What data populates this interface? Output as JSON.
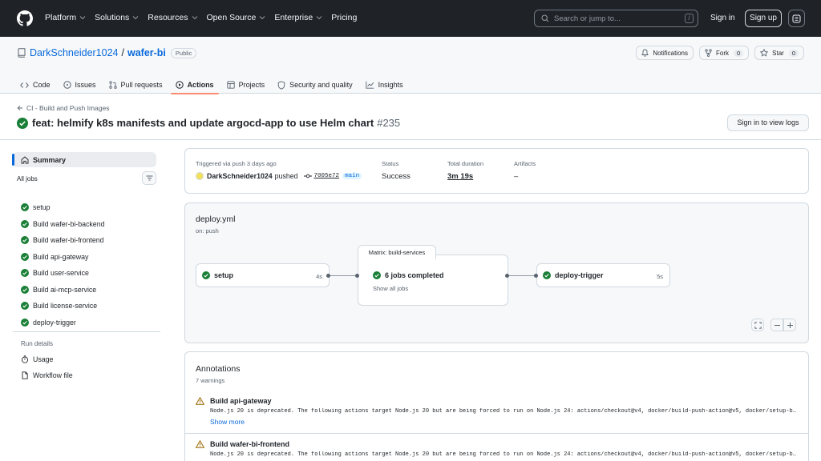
{
  "global_nav": {
    "items": [
      "Platform",
      "Solutions",
      "Resources",
      "Open Source",
      "Enterprise",
      "Pricing"
    ],
    "search_placeholder": "Search or jump to...",
    "search_shortcut": "/",
    "signin": "Sign in",
    "signup": "Sign up"
  },
  "repo": {
    "owner": "DarkSchneider1024",
    "separator": "/",
    "name": "wafer-bi",
    "visibility": "Public",
    "notifications": "Notifications",
    "fork_label": "Fork",
    "fork_count": "0",
    "star_label": "Star",
    "star_count": "0",
    "tabs": [
      "Code",
      "Issues",
      "Pull requests",
      "Actions",
      "Projects",
      "Security and quality",
      "Insights"
    ],
    "active_tab": "Actions"
  },
  "run": {
    "breadcrumb": "CI - Build and Push Images",
    "title": "feat: helmify k8s manifests and update argocd-app to use Helm chart",
    "number": "#235",
    "view_logs": "Sign in to view logs"
  },
  "sidebar": {
    "summary": "Summary",
    "all_jobs": "All jobs",
    "jobs": [
      "setup",
      "Build wafer-bi-backend",
      "Build wafer-bi-frontend",
      "Build api-gateway",
      "Build user-service",
      "Build ai-mcp-service",
      "Build license-service",
      "deploy-trigger"
    ],
    "run_details": "Run details",
    "usage": "Usage",
    "workflow_file": "Workflow file"
  },
  "summary": {
    "trigger_label": "Triggered via push 3 days ago",
    "user": "DarkSchneider1024",
    "action": "pushed",
    "commit": "7005e72",
    "branch": "main",
    "status_label": "Status",
    "status_value": "Success",
    "duration_label": "Total duration",
    "duration_value": "3m 19s",
    "artifacts_label": "Artifacts",
    "artifacts_value": "–"
  },
  "workflow": {
    "file": "deploy.yml",
    "on": "on: push",
    "setup_name": "setup",
    "setup_duration": "4s",
    "matrix_label": "Matrix: build-services",
    "matrix_status": "6 jobs completed",
    "matrix_link": "Show all jobs",
    "deploy_name": "deploy-trigger",
    "deploy_duration": "5s"
  },
  "annotations": {
    "title": "Annotations",
    "count": "7 warnings",
    "items": [
      {
        "job": "Build api-gateway",
        "message": "Node.js 20 is deprecated. The following actions target Node.js 20 but are being forced to run on Node.js 24: actions/checkout@v4, docker/build-push-action@v5, docker/setup-b…",
        "more": "Show more"
      },
      {
        "job": "Build wafer-bi-frontend",
        "message": "Node.js 20 is deprecated. The following actions target Node.js 20 but are being forced to run on Node.js 24: actions/checkout@v4, docker/build-push-action@v5, docker/setup-b…"
      }
    ]
  },
  "colors": {
    "success": "#1a7f37",
    "link": "#0969da",
    "warning": "#9a6700",
    "active_tab_underline": "#fd8c73",
    "header_bg": "#1f2328"
  }
}
